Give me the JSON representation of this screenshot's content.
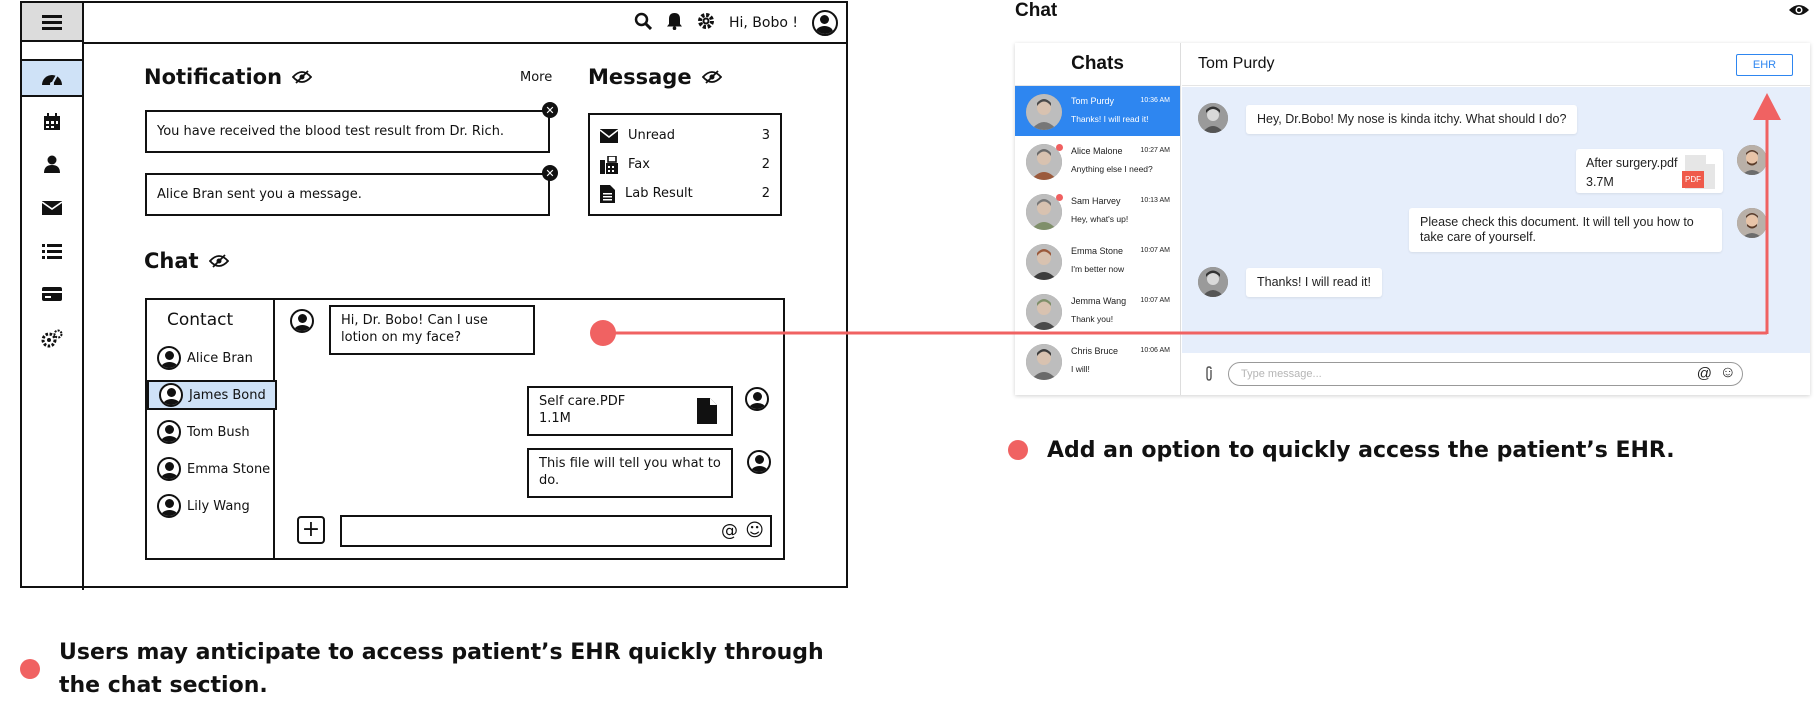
{
  "wireframe": {
    "topbar": {
      "greeting": "Hi, Bobo !"
    },
    "notification": {
      "title": "Notification",
      "more_label": "More",
      "items": [
        "You have received the blood test result from Dr. Rich.",
        "Alice Bran sent you a message."
      ]
    },
    "message": {
      "title": "Message",
      "rows": [
        {
          "label": "Unread",
          "count": "3",
          "icon": "mail-icon"
        },
        {
          "label": "Fax",
          "count": "2",
          "icon": "fax-icon"
        },
        {
          "label": "Lab Result",
          "count": "2",
          "icon": "document-icon"
        }
      ]
    },
    "chat": {
      "title": "Chat",
      "contacts_title": "Contact",
      "contacts": [
        "Alice Bran",
        "James Bond",
        "Tom Bush",
        "Emma Stone",
        "Lily Wang"
      ],
      "active_contact": "James Bond",
      "messages": [
        "Hi, Dr. Bobo! Can I use lotion on my face?",
        "Self care.PDF",
        "1.1M",
        "This file will tell you what to do."
      ],
      "input_icons": [
        "@",
        "☺"
      ]
    },
    "sidebar_icons": [
      "dashboard-icon",
      "calendar-icon",
      "user-icon",
      "mail-icon",
      "list-icon",
      "card-icon",
      "settings-icon"
    ]
  },
  "mockup": {
    "section_title": "Chat",
    "list_title": "Chats",
    "header_name": "Tom Purdy",
    "ehr_button": "EHR",
    "conversations": [
      {
        "name": "Tom Purdy",
        "time": "10:36 AM",
        "preview": "Thanks! I will read it!",
        "active": true,
        "unread": false
      },
      {
        "name": "Alice Malone",
        "time": "10:27 AM",
        "preview": "Anything else I need?",
        "active": false,
        "unread": true
      },
      {
        "name": "Sam Harvey",
        "time": "10:13 AM",
        "preview": "Hey, what's up!",
        "active": false,
        "unread": true
      },
      {
        "name": "Emma Stone",
        "time": "10:07 AM",
        "preview": "I'm better now",
        "active": false,
        "unread": false
      },
      {
        "name": "Jemma Wang",
        "time": "10:07 AM",
        "preview": "Thank you!",
        "active": false,
        "unread": false
      },
      {
        "name": "Chris Bruce",
        "time": "10:06 AM",
        "preview": "I will!",
        "active": false,
        "unread": false
      }
    ],
    "messages": [
      {
        "from": "patient",
        "text": "Hey, Dr.Bobo! My nose is kinda itchy. What should I do?"
      },
      {
        "from": "doctor",
        "file_name": "After surgery.pdf",
        "file_size": "3.7M",
        "file_badge": "PDF"
      },
      {
        "from": "doctor",
        "text": "Please check this document. It will tell you how to take care of yourself."
      },
      {
        "from": "patient",
        "text": "Thanks! I will read it!"
      }
    ],
    "input_placeholder": "Type message...",
    "input_icons": [
      "@",
      "☺"
    ]
  },
  "captions": {
    "left": "Users may anticipate to access patient’s EHR quickly through the chat section.",
    "right": "Add an option to quickly access the patient’s EHR."
  },
  "colors": {
    "accent_red": "#f06262",
    "accent_blue": "#2e86f0",
    "highlight_blue": "#cfe2f7"
  }
}
